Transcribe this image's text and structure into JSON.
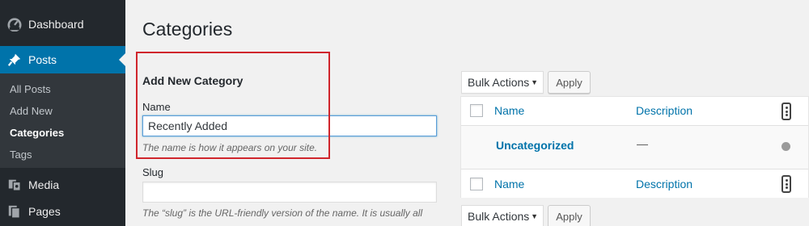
{
  "sidebar": {
    "menu": [
      {
        "label": "Dashboard",
        "icon": "dashboard-icon"
      },
      {
        "label": "Posts",
        "icon": "pin-icon",
        "current": true
      },
      {
        "label": "Media",
        "icon": "media-icon"
      },
      {
        "label": "Pages",
        "icon": "pages-icon"
      }
    ],
    "submenu": [
      {
        "label": "All Posts"
      },
      {
        "label": "Add New"
      },
      {
        "label": "Categories",
        "current": true
      },
      {
        "label": "Tags"
      }
    ]
  },
  "page": {
    "title": "Categories"
  },
  "form": {
    "title": "Add New Category",
    "name_label": "Name",
    "name_value": "Recently Added",
    "name_description": "The name is how it appears on your site.",
    "slug_label": "Slug",
    "slug_value": "",
    "slug_description": "The “slug” is the URL-friendly version of the name. It is usually all"
  },
  "bulk": {
    "select_label": "Bulk Actions",
    "apply_label": "Apply"
  },
  "table": {
    "headers": {
      "name": "Name",
      "description": "Description"
    },
    "rows": [
      {
        "name": "Uncategorized",
        "description": "—"
      }
    ]
  },
  "colors": {
    "sidebar_bg": "#23282d",
    "accent": "#0073aa",
    "highlight": "#d0252c",
    "background": "#f1f1f1"
  }
}
